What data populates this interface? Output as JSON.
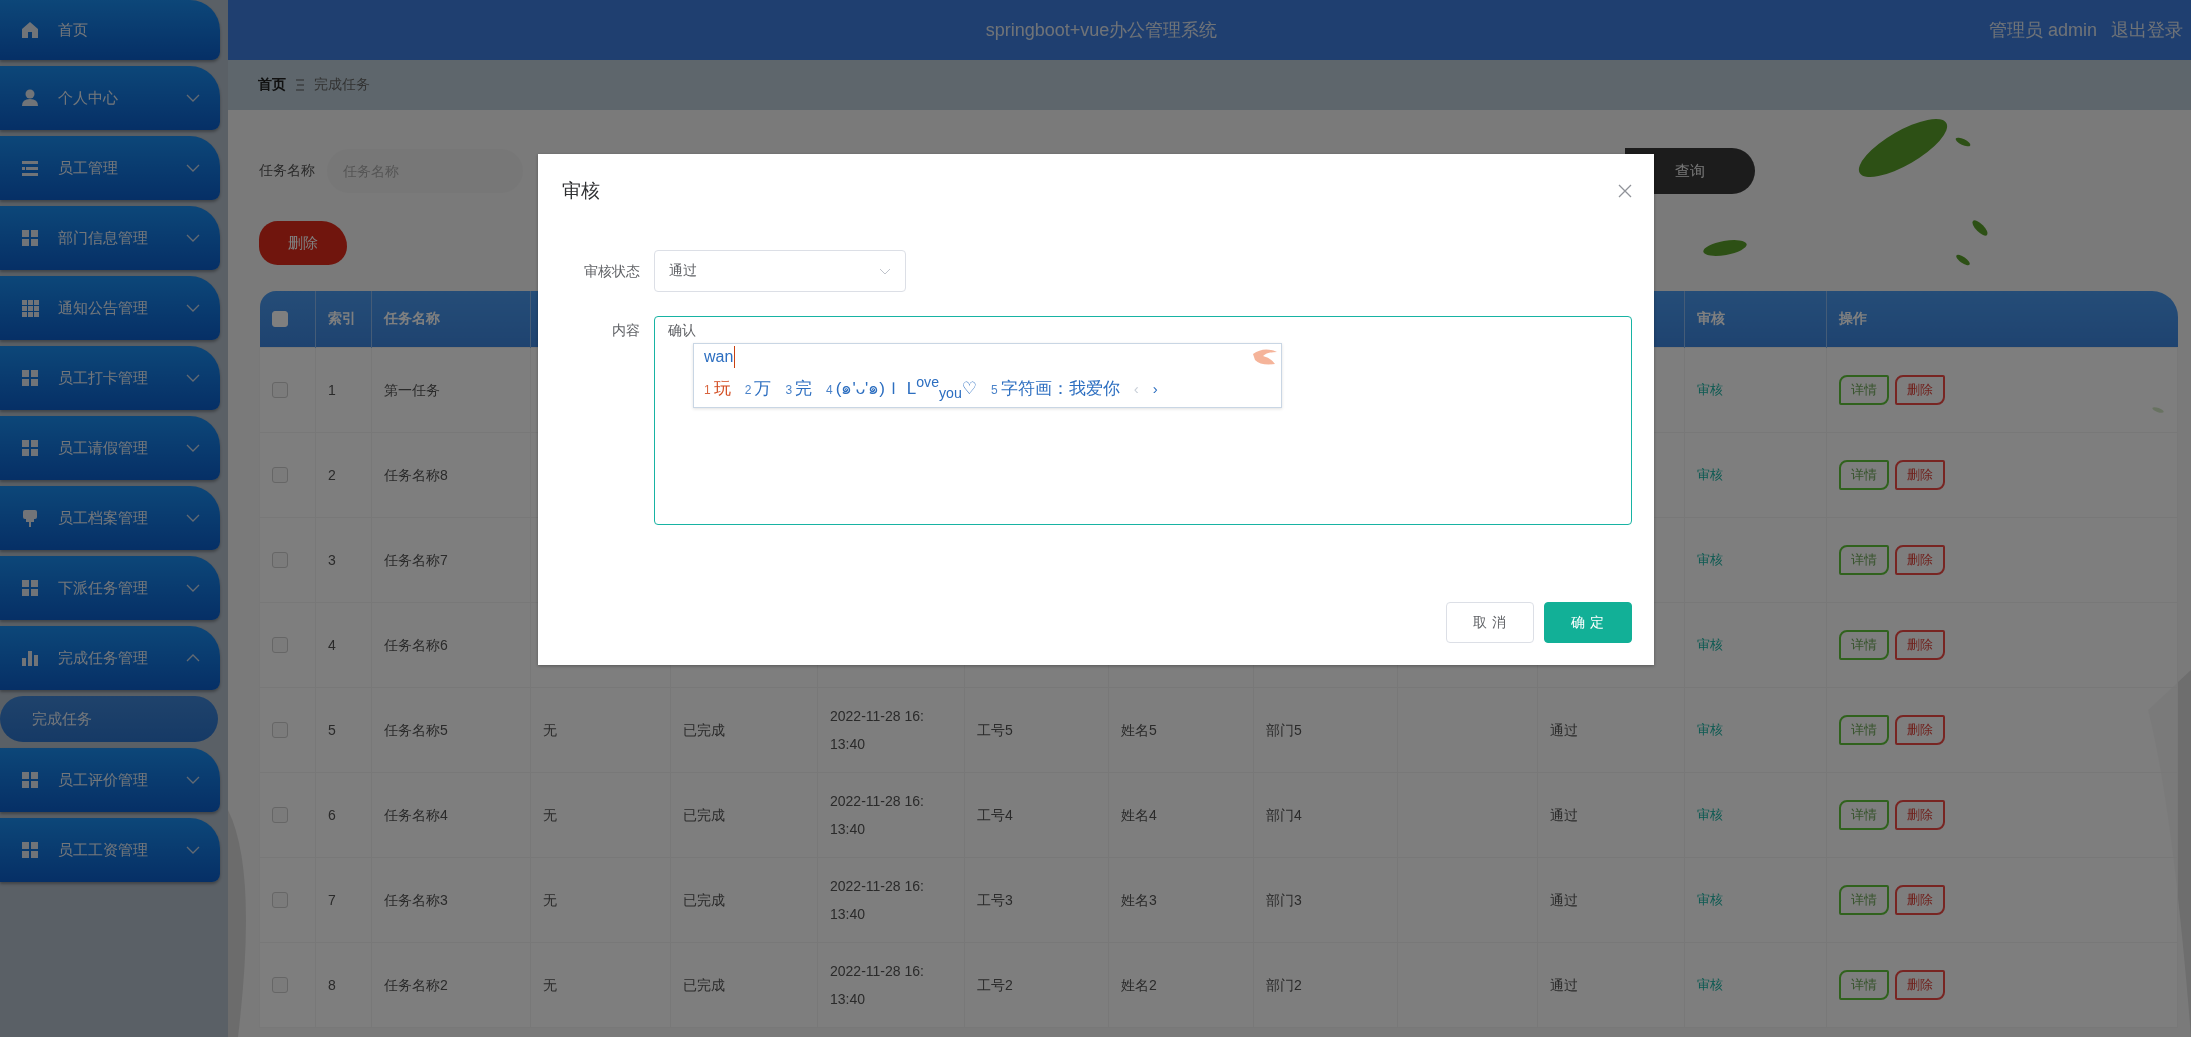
{
  "sidebar": {
    "items": [
      {
        "label": "首页"
      },
      {
        "label": "个人中心",
        "expanded": false
      },
      {
        "label": "员工管理",
        "expanded": false
      },
      {
        "label": "部门信息管理",
        "expanded": false
      },
      {
        "label": "通知公告管理",
        "expanded": false
      },
      {
        "label": "员工打卡管理",
        "expanded": false
      },
      {
        "label": "员工请假管理",
        "expanded": false
      },
      {
        "label": "员工档案管理",
        "expanded": false
      },
      {
        "label": "下派任务管理",
        "expanded": false
      },
      {
        "label": "完成任务管理",
        "expanded": true,
        "children": [
          {
            "label": "完成任务",
            "selected": true
          }
        ]
      },
      {
        "label": "员工评价管理",
        "expanded": false
      },
      {
        "label": "员工工资管理",
        "expanded": false
      }
    ]
  },
  "header": {
    "title": "springboot+vue办公管理系统",
    "user": "管理员 admin",
    "logout": "退出登录"
  },
  "breadcrumb": [
    "首页",
    "完成任务"
  ],
  "search": {
    "label": "任务名称",
    "placeholder": "任务名称",
    "button": "查询"
  },
  "delete_button": "删除",
  "table": {
    "header_checked": false,
    "columns": [
      "索引",
      "任务名称",
      null,
      null,
      null,
      null,
      null,
      null,
      null,
      null,
      "审核",
      "操作"
    ],
    "rows": [
      {
        "checked": false,
        "index": "1",
        "task_name": "第一任务",
        "review": "审核",
        "actions": [
          "详情",
          "删除"
        ]
      },
      {
        "checked": false,
        "index": "2",
        "task_name": "任务名称8",
        "review": "审核",
        "actions": [
          "详情",
          "删除"
        ]
      },
      {
        "checked": false,
        "index": "3",
        "task_name": "任务名称7",
        "review": "审核",
        "actions": [
          "详情",
          "删除"
        ]
      },
      {
        "checked": false,
        "index": "4",
        "task_name": "任务名称6",
        "review": "审核",
        "actions": [
          "详情",
          "删除"
        ]
      },
      {
        "checked": false,
        "index": "5",
        "task_name": "任务名称5",
        "middle": [
          "无",
          "已完成",
          "2022-11-28 16:13:40",
          "工号5",
          "姓名5",
          "部门5"
        ],
        "status": "通过",
        "review": "审核",
        "actions": [
          "详情",
          "删除"
        ]
      },
      {
        "checked": false,
        "index": "6",
        "task_name": "任务名称4",
        "middle": [
          "无",
          "已完成",
          "2022-11-28 16:13:40",
          "工号4",
          "姓名4",
          "部门4"
        ],
        "status": "通过",
        "review": "审核",
        "actions": [
          "详情",
          "删除"
        ]
      },
      {
        "checked": false,
        "index": "7",
        "task_name": "任务名称3",
        "middle": [
          "无",
          "已完成",
          "2022-11-28 16:13:40",
          "工号3",
          "姓名3",
          "部门3"
        ],
        "status": "通过",
        "review": "审核",
        "actions": [
          "详情",
          "删除"
        ]
      },
      {
        "checked": false,
        "index": "8",
        "task_name": "任务名称2",
        "middle": [
          "无",
          "已完成",
          "2022-11-28 16:13:40",
          "工号2",
          "姓名2",
          "部门2"
        ],
        "status": "通过",
        "review": "审核",
        "actions": [
          "详情",
          "删除"
        ]
      }
    ]
  },
  "dialog": {
    "title": "审核",
    "status_label": "审核状态",
    "status_value": "通过",
    "content_label": "内容",
    "content_value": "确认",
    "ime": {
      "composition": "wan",
      "candidates": [
        {
          "number": "1",
          "text": "玩",
          "selected": true
        },
        {
          "number": "2",
          "text": "万",
          "selected": false
        },
        {
          "number": "3",
          "text": "完",
          "selected": false
        },
        {
          "number": "4",
          "text": "(๑'ᴗ'๑)Ｉ L$^{ove}$$_{you}$♡",
          "selected": false
        },
        {
          "number": "5",
          "text": "字符画：我爱你",
          "selected": false
        }
      ],
      "nav": [
        {
          "label": "‹",
          "disabled": true
        },
        {
          "label": "›",
          "disabled": false
        }
      ]
    },
    "buttons": [
      "取 消",
      "确 定"
    ]
  }
}
